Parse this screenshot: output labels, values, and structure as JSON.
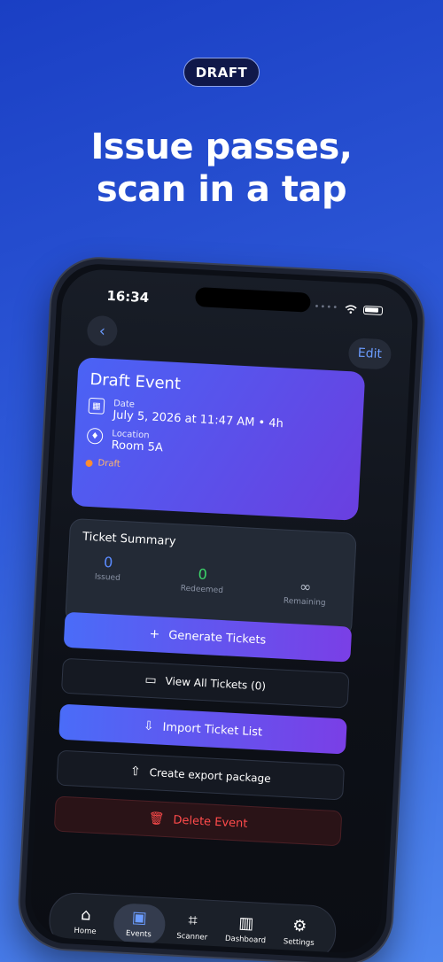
{
  "badge": "DRAFT",
  "headline": [
    "Issue passes,",
    "scan in a tap"
  ],
  "status_bar": {
    "time": "16:34"
  },
  "nav": {
    "back_icon": "chevron-left-icon",
    "edit_label": "Edit"
  },
  "event": {
    "title": "Draft Event",
    "date_label": "Date",
    "date_value": "July 5, 2026 at 11:47 AM • 4h",
    "location_label": "Location",
    "location_value": "Room 5A",
    "status": "Draft"
  },
  "summary": {
    "title": "Ticket Summary",
    "stats": [
      {
        "value": "0",
        "label": "Issued"
      },
      {
        "value": "0",
        "label": "Redeemed"
      },
      {
        "value": "∞",
        "label": "Remaining"
      }
    ]
  },
  "actions": {
    "generate": "Generate Tickets",
    "view_all": "View All Tickets (0)",
    "import": "Import Ticket List",
    "export": "Create export package",
    "delete": "Delete Event"
  },
  "tabs": [
    {
      "label": "Home",
      "icon": "home-icon"
    },
    {
      "label": "Events",
      "icon": "events-icon"
    },
    {
      "label": "Scanner",
      "icon": "qr-scanner-icon"
    },
    {
      "label": "Dashboard",
      "icon": "bar-chart-icon"
    },
    {
      "label": "Settings",
      "icon": "gear-icon"
    }
  ],
  "colors": {
    "accent": "#6b9cff",
    "danger": "#ff4b4b",
    "draft": "#ff8c30"
  }
}
